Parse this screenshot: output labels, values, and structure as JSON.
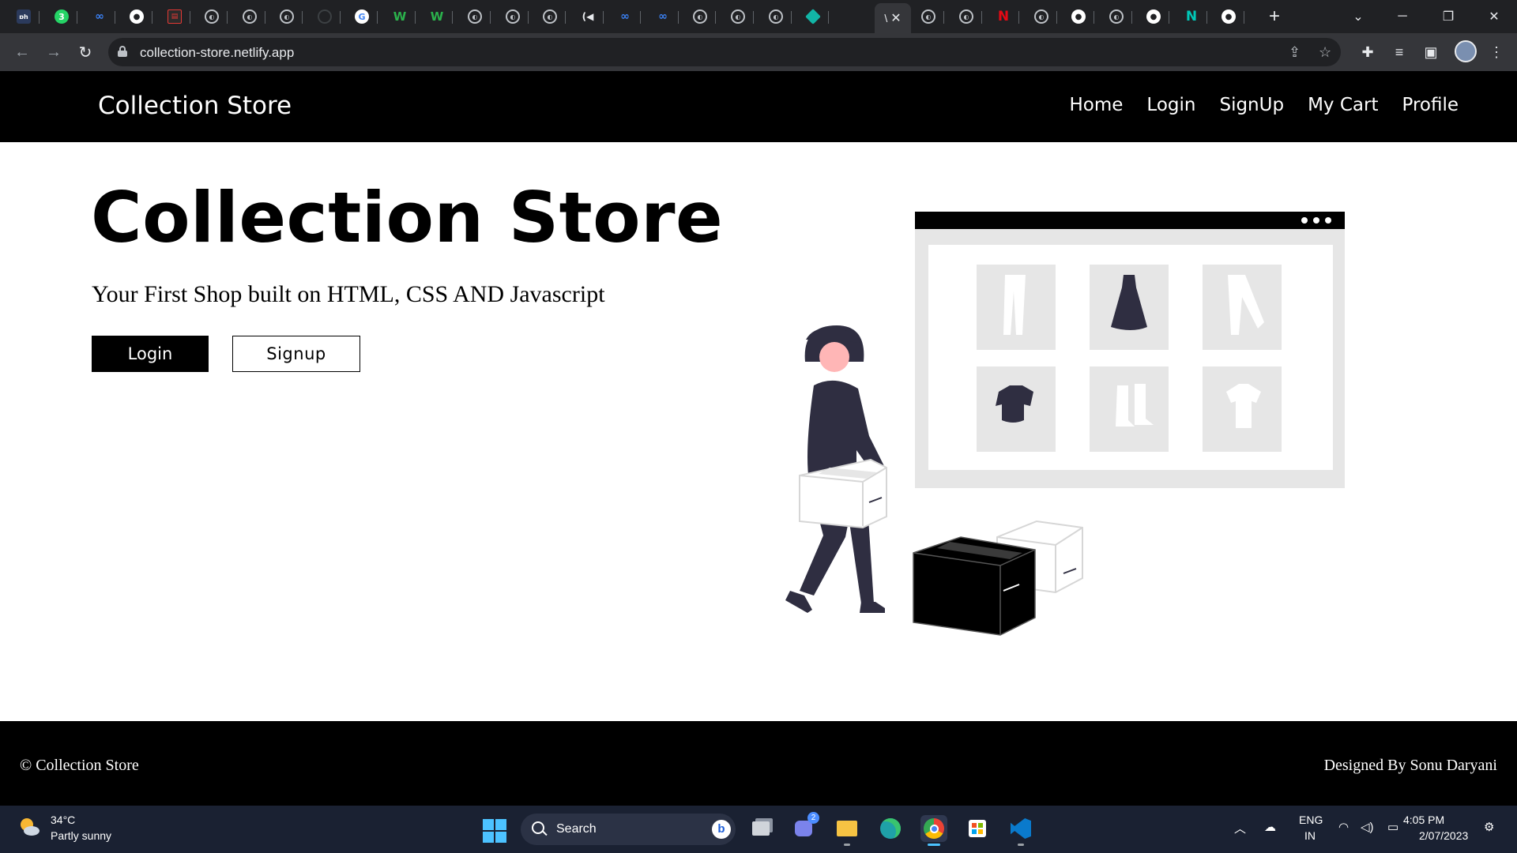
{
  "browser": {
    "url": "collection-store.netlify.app",
    "tab_icons": [
      "dark-icon",
      "whatsapp-icon",
      "meta-icon",
      "github-icon",
      "red-box-icon",
      "globe-icon",
      "globe-icon",
      "globe-icon",
      "empty-icon",
      "google-icon",
      "w-icon",
      "w-icon",
      "globe-icon",
      "globe-icon",
      "globe-icon",
      "audio-icon",
      "meta-icon",
      "meta-icon",
      "globe-icon",
      "globe-icon",
      "globe-icon",
      "diamond-icon",
      "active-tab",
      "globe-icon",
      "globe-icon",
      "netflix-icon",
      "globe-icon",
      "github-icon",
      "globe-icon",
      "github-icon",
      "netlify-icon",
      "github-icon"
    ],
    "whatsapp_badge": "3",
    "dark_tab_label": "ɒh",
    "active_tab_char": "\\",
    "new_tab": "+",
    "close_tab": "✕"
  },
  "site": {
    "brand": "Collection Store",
    "nav": [
      "Home",
      "Login",
      "SignUp",
      "My Cart",
      "Profile"
    ],
    "hero_title": "Collection Store",
    "hero_subtitle": "Your First Shop built on HTML, CSS AND Javascript",
    "login_button": "Login",
    "signup_button": "Signup",
    "footer_left": "© Collection Store",
    "footer_right": "Designed By Sonu Daryani"
  },
  "taskbar": {
    "temperature": "34°C",
    "weather": "Partly sunny",
    "search_label": "Search",
    "teams_badge": "2",
    "lang_line1": "ENG",
    "lang_line2": "IN",
    "time": "4:05 PM",
    "date": "2/07/2023"
  },
  "colors": {
    "accent_dark": "#2f2e41",
    "skin": "#ffb6b6",
    "panel_gray": "#e6e6e6",
    "taskbar_accent": "#4cc2ff"
  }
}
